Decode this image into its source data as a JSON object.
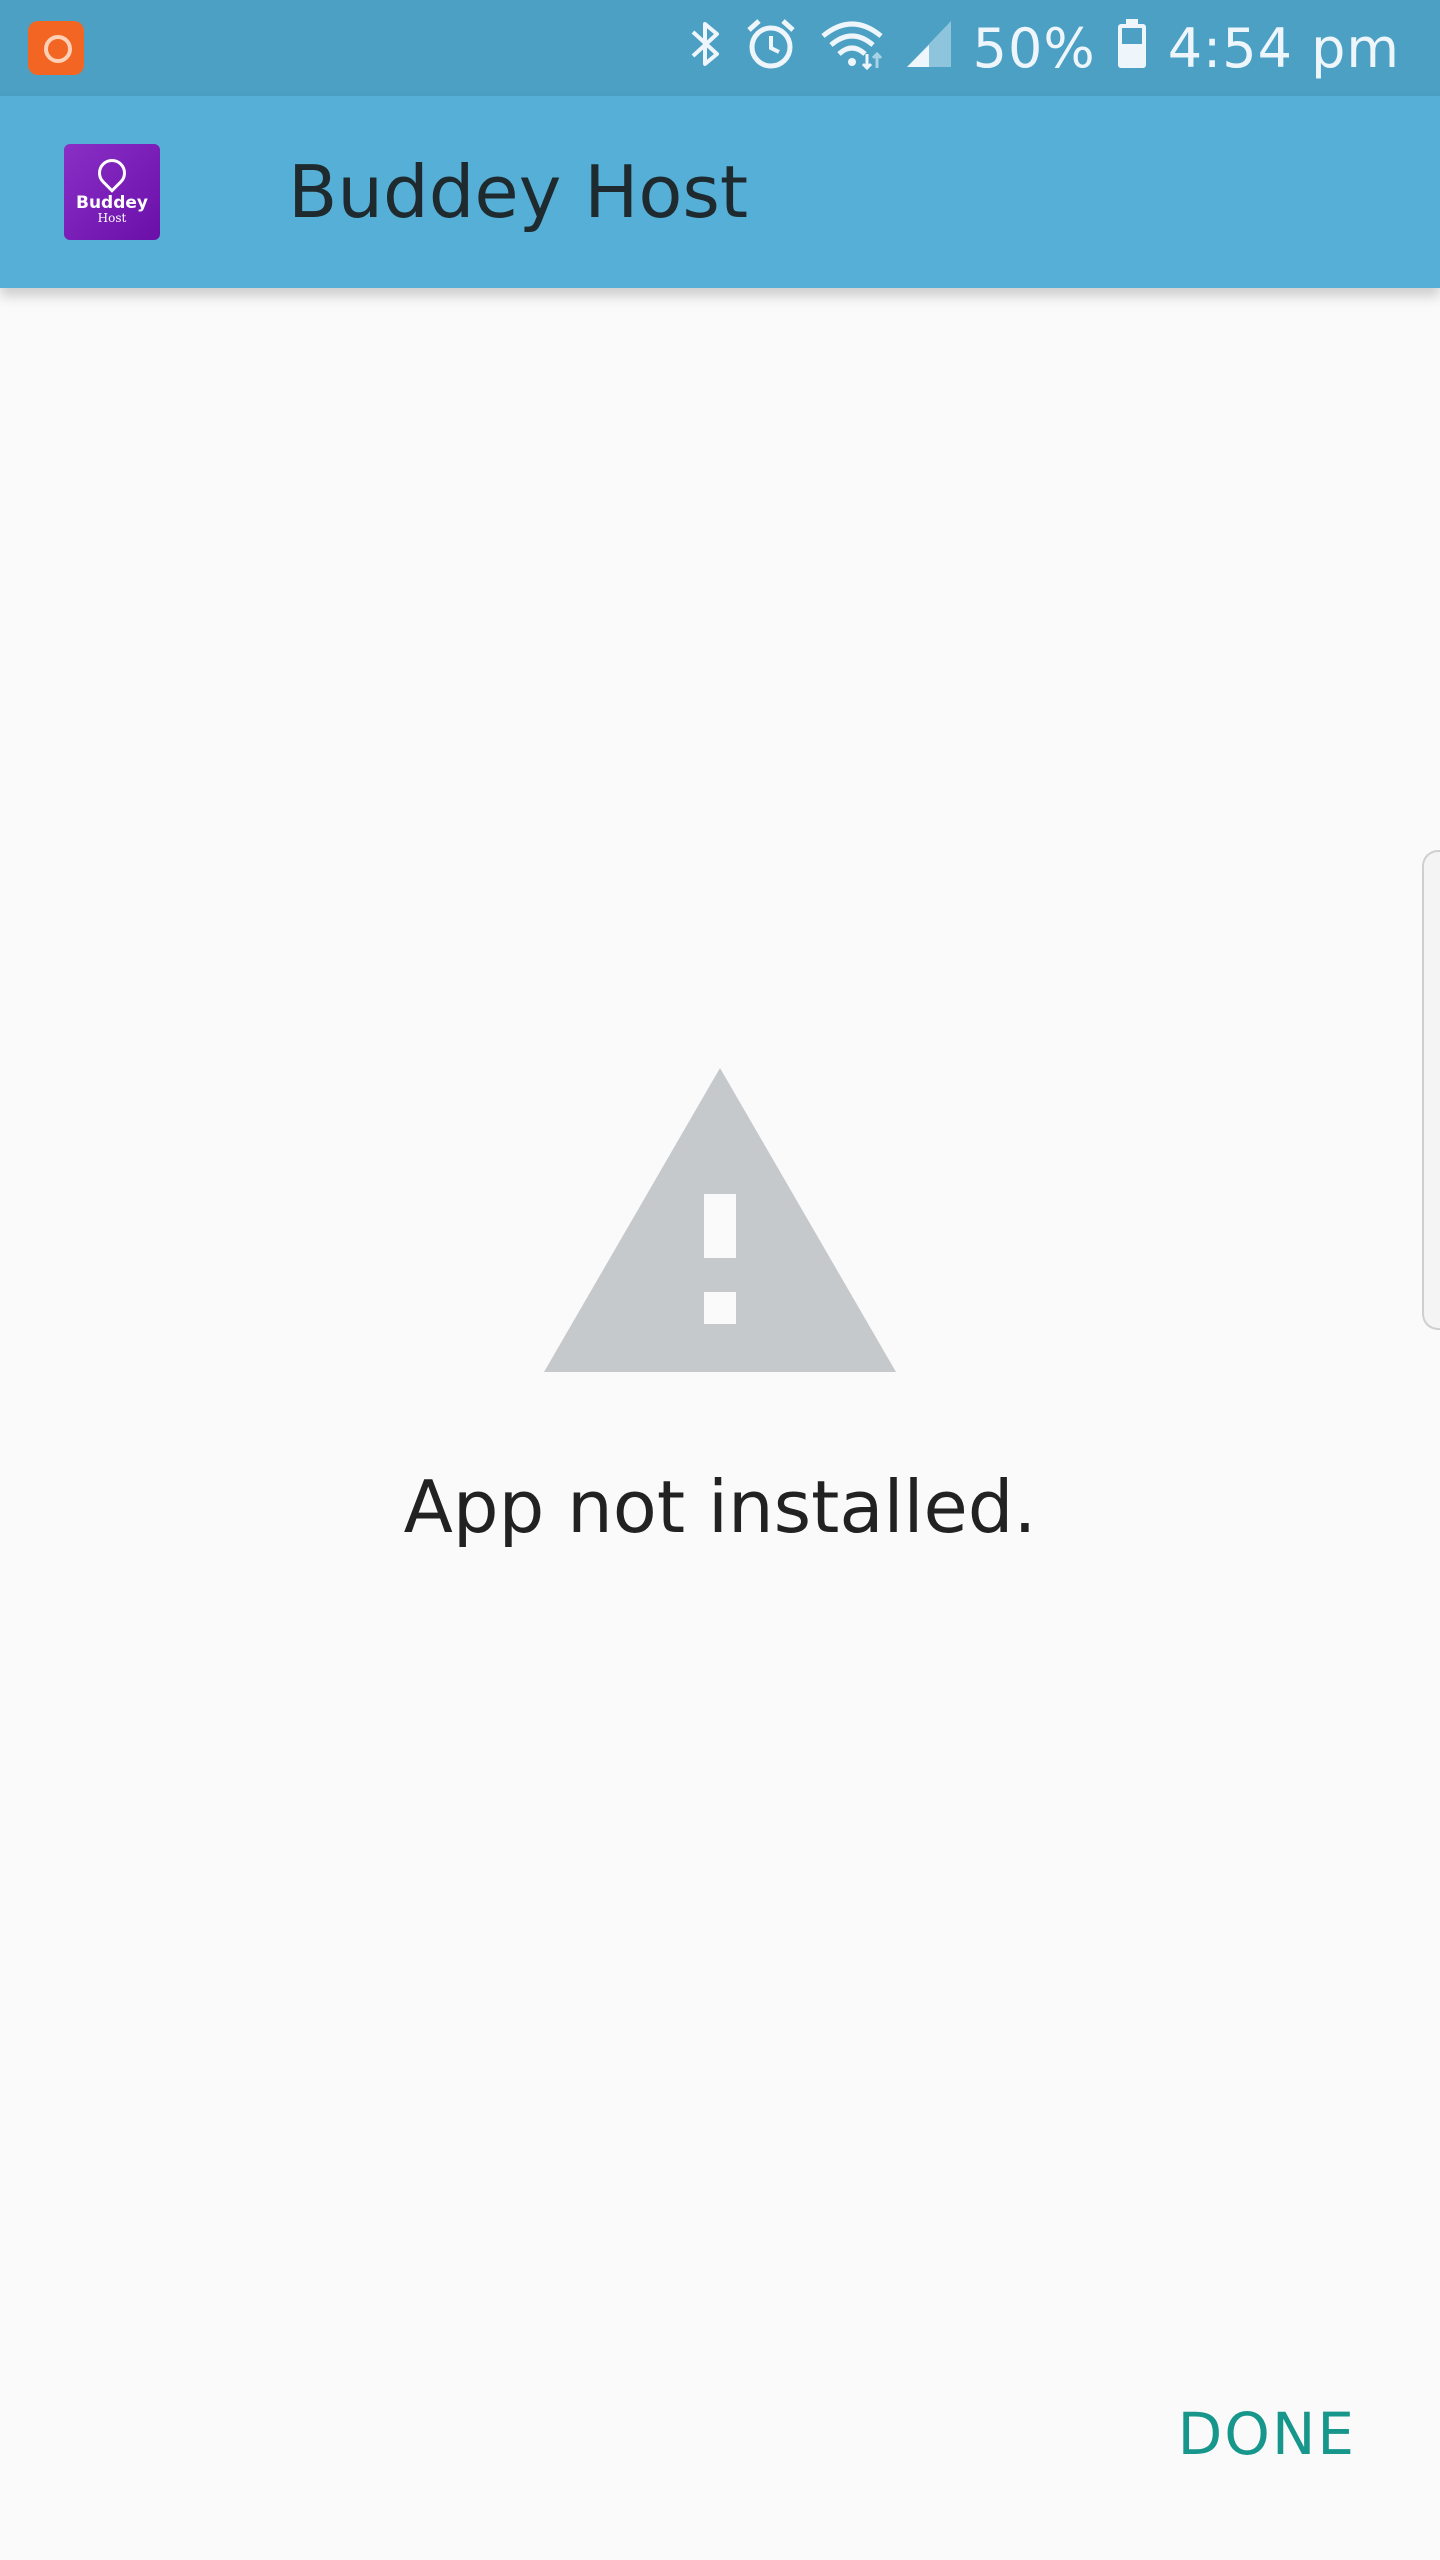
{
  "status_bar": {
    "battery": "50%",
    "time": "4:54 pm",
    "icons": [
      "notification-app-icon",
      "bluetooth-icon",
      "alarm-icon",
      "wifi-icon",
      "cell-signal-icon",
      "battery-icon"
    ]
  },
  "app_bar": {
    "title": "Buddey Host",
    "logo_line1": "Buddey",
    "logo_line2": "Host"
  },
  "main": {
    "message": "App not installed.",
    "icon": "warning-icon"
  },
  "footer": {
    "done_label": "DONE"
  },
  "colors": {
    "status_bar": "#4ba0c4",
    "app_bar": "#55afd6",
    "background": "#fafafa",
    "warning_icon": "#c6c9cc",
    "done_text": "#17968c",
    "logo": "#7a1fb8"
  }
}
